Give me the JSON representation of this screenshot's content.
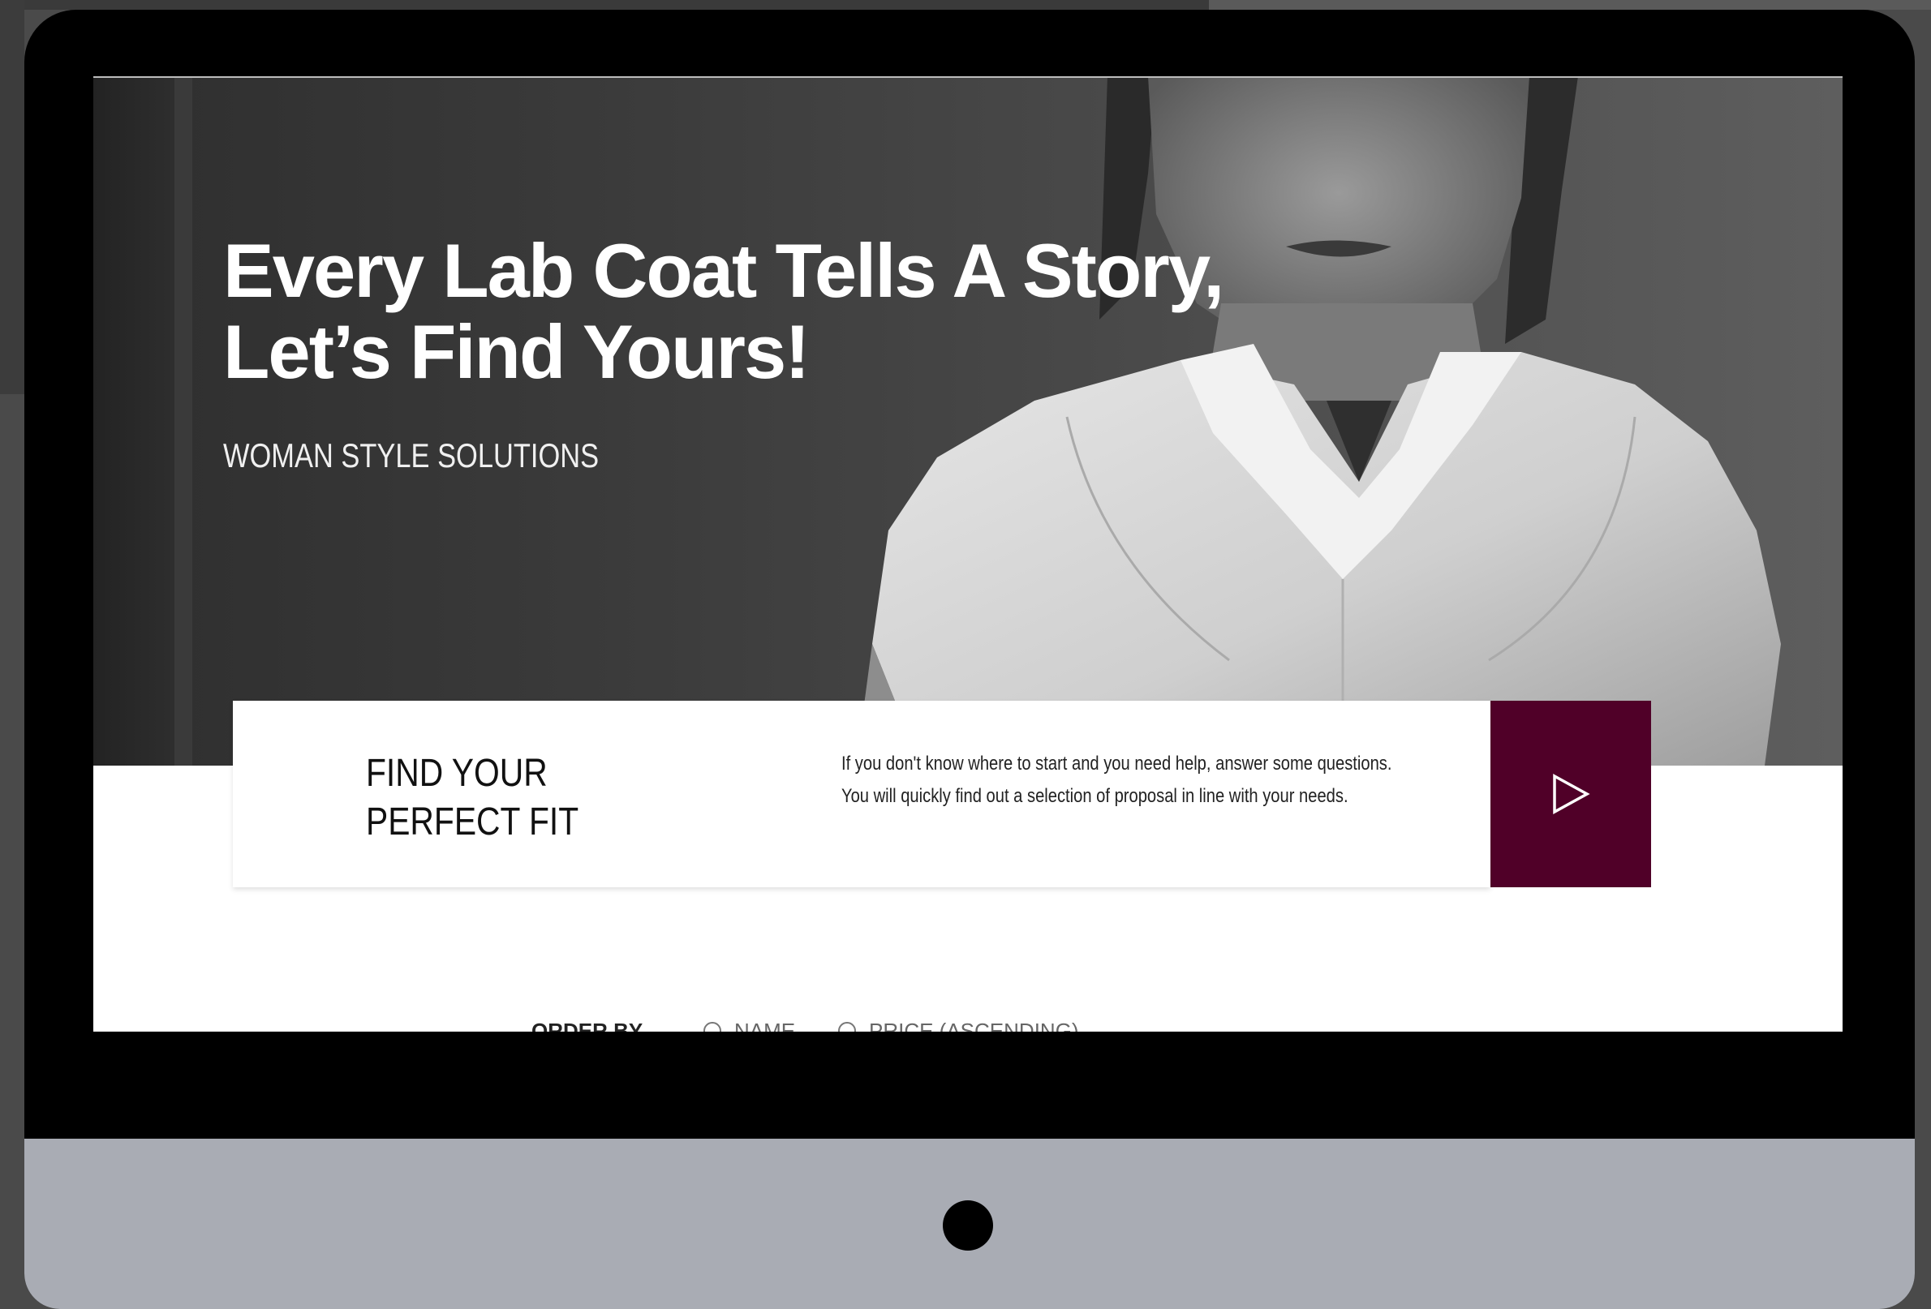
{
  "hero": {
    "title": "Every Lab Coat Tells A Story,\nLet’s Find Yours!",
    "subtitle": "WOMAN STYLE SOLUTIONS"
  },
  "fit_card": {
    "title": "FIND YOUR PERFECT FIT",
    "line1": "If you don't know where to start and you need help, answer some questions.",
    "line2": "You will quickly find out a selection of proposal in line with your needs.",
    "button_icon": "play-triangle-icon"
  },
  "order": {
    "label": "ORDER BY",
    "option_name": "NAME",
    "option_price": "PRICE (ASCENDING)"
  },
  "colors": {
    "accent": "#500028",
    "hero_bg": "#3b3b3b",
    "device_chin": "#a9acb4"
  }
}
